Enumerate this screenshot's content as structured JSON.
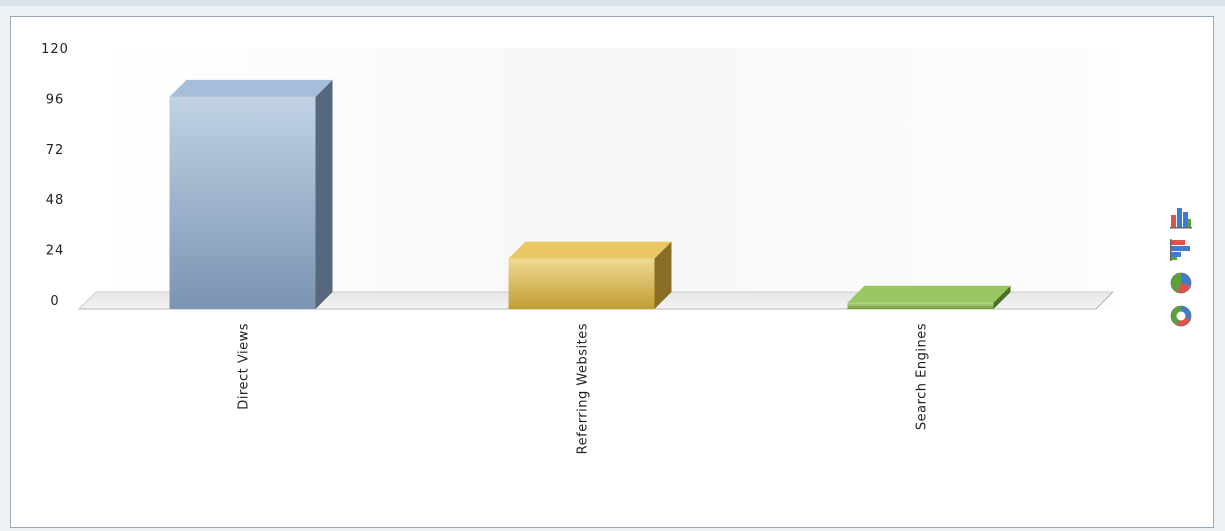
{
  "chart_data": {
    "type": "bar",
    "categories": [
      "Direct Views",
      "Referring Websites",
      "Search Engines"
    ],
    "values": [
      101,
      24,
      3
    ],
    "ylim": [
      0,
      120
    ],
    "yticks": [
      0,
      24,
      48,
      72,
      96,
      120
    ],
    "grid": false,
    "colors": [
      "#8faed0",
      "#e3b93d",
      "#7fb83a"
    ]
  },
  "switcher": {
    "buttons": [
      {
        "icon": "column-chart-icon"
      },
      {
        "icon": "bar-chart-icon"
      },
      {
        "icon": "pie-chart-icon"
      },
      {
        "icon": "doughnut-chart-icon"
      }
    ]
  }
}
